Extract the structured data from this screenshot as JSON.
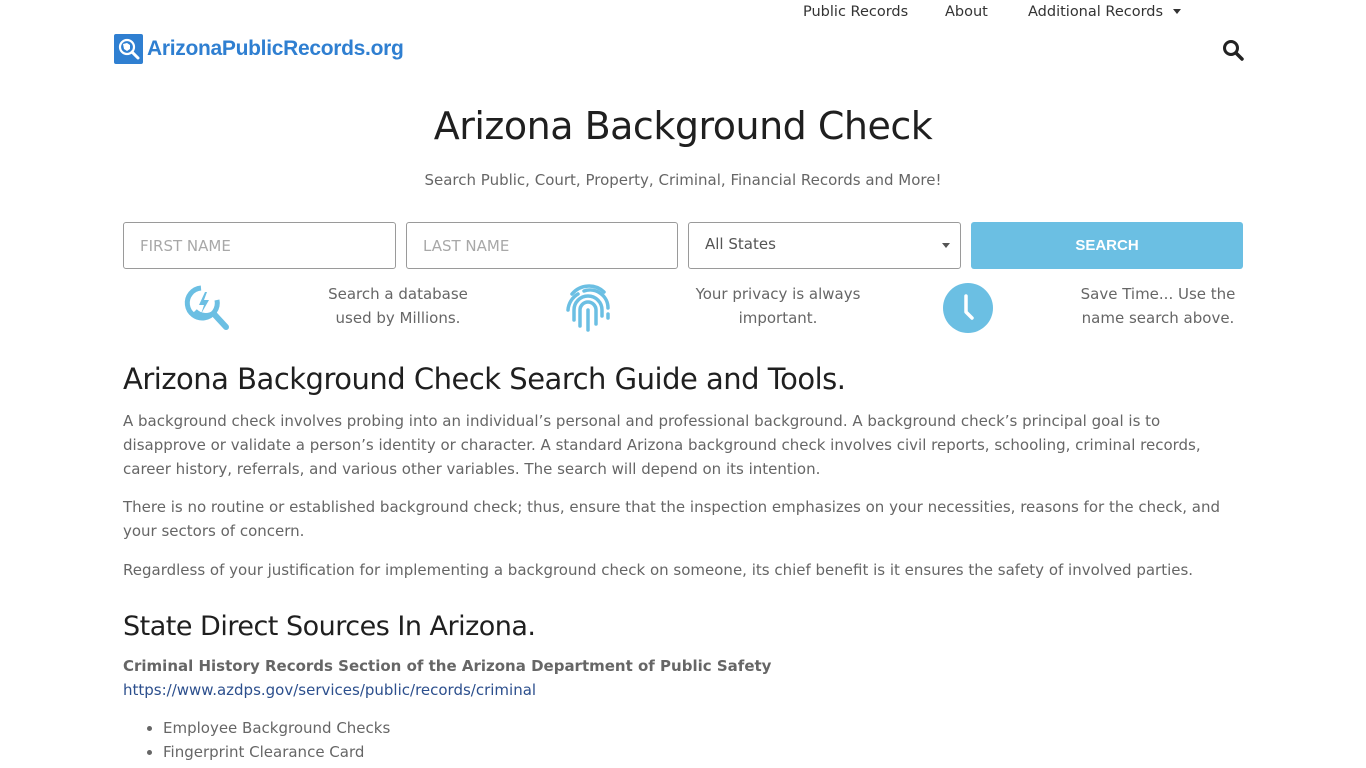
{
  "header": {
    "logo_text": "ArizonaPublicRecords.org",
    "nav": [
      {
        "label": "Public Records"
      },
      {
        "label": "About"
      },
      {
        "label": "Additional Records",
        "has_dropdown": true
      }
    ],
    "search_icon": "search-icon"
  },
  "hero": {
    "title": "Arizona Background Check",
    "subtitle": "Search Public, Court, Property, Criminal, Financial Records and More!"
  },
  "search_form": {
    "first_name_placeholder": "FIRST NAME",
    "first_name_value": "",
    "last_name_placeholder": "LAST NAME",
    "last_name_value": "",
    "state_selected": "All States",
    "button_label": "SEARCH"
  },
  "features": [
    {
      "icon": "search-bolt-icon",
      "text_line1": "Search a database",
      "text_line2": "used by Millions."
    },
    {
      "icon": "fingerprint-icon",
      "text_line1": "Your privacy is always",
      "text_line2": "important."
    },
    {
      "icon": "clock-icon",
      "text_line1": "Save Time... Use the",
      "text_line2": "name search above."
    }
  ],
  "article": {
    "heading": "Arizona Background Check Search Guide and Tools.",
    "paragraphs": [
      "A background check involves probing into an individual’s personal and professional background. A background check’s principal goal is to disapprove or validate a person’s identity or character. A standard Arizona background check involves civil reports, schooling, criminal records, career history, referrals, and various other variables. The search will depend on its intention.",
      "There is no routine or established background check; thus, ensure that the inspection emphasizes on your necessities, reasons for the check, and your sectors of concern.",
      "Regardless of your justification for implementing a background check on someone, its chief benefit is it ensures the safety of involved parties."
    ],
    "sources_heading": "State Direct Sources In Arizona.",
    "source": {
      "title": "Criminal History Records Section of the Arizona Department of Public Safety",
      "link": "https://www.azdps.gov/services/public/records/criminal",
      "items": [
        "Employee Background Checks",
        "Fingerprint Clearance Card"
      ]
    }
  },
  "colors": {
    "brand": "#2f7fd1",
    "accent": "#6bbfe3",
    "link": "#2c4f8d",
    "heading": "#1f1f1f",
    "body": "#666666"
  }
}
